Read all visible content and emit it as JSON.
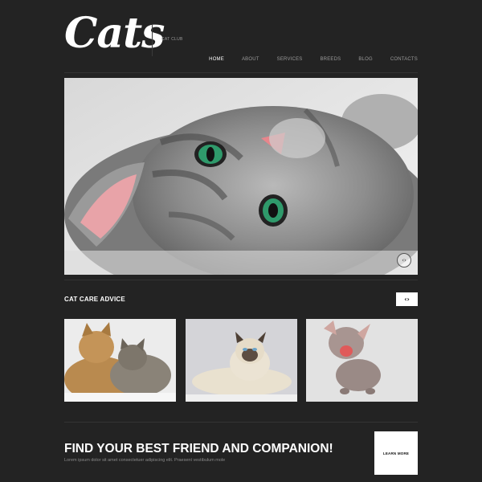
{
  "header": {
    "logo": "Cats",
    "tagline": "CAT CLUB",
    "nav": [
      {
        "label": "HOME",
        "active": true
      },
      {
        "label": "ABOUT",
        "active": false
      },
      {
        "label": "SERVICES",
        "active": false
      },
      {
        "label": "BREEDS",
        "active": false
      },
      {
        "label": "BLOG",
        "active": false
      },
      {
        "label": "CONTACTS",
        "active": false
      }
    ]
  },
  "hero": {
    "image": "kitten-photo",
    "slider_control": "‹›"
  },
  "advice": {
    "title": "CAT CARE ADVICE",
    "arrows": "‹›",
    "images": [
      "two-cats-photo",
      "siamese-cat-photo",
      "sphynx-kitten-photo"
    ]
  },
  "cta": {
    "title": "FIND YOUR BEST FRIEND AND COMPANION!",
    "subtitle": "Lorem ipsum dolor sit amet consectetuer adipiscing elit. Praesent vestibulum mole",
    "button": "LEARN MORE"
  },
  "colors": {
    "background": "#232323",
    "text": "#ffffff",
    "muted": "#9a9a9a",
    "button_bg": "#ffffff"
  }
}
